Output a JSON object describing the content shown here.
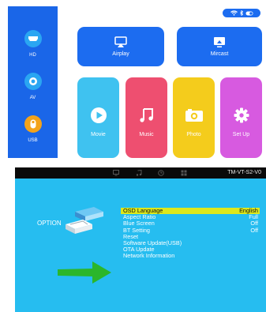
{
  "sidebar": {
    "items": [
      {
        "label": "HD",
        "icon": "hdmi-icon",
        "color": "#2aa6f2"
      },
      {
        "label": "AV",
        "icon": "av-icon",
        "color": "#2aa6f2"
      },
      {
        "label": "USB",
        "icon": "usb-icon",
        "color": "#f3a31b"
      }
    ]
  },
  "status": {
    "icons": [
      "wifi-icon",
      "bluetooth-icon",
      "toggle-icon"
    ]
  },
  "tiles": {
    "airplay": {
      "label": "Airplay",
      "icon": "airplay-icon"
    },
    "mircast": {
      "label": "Mircast",
      "icon": "cast-icon"
    },
    "movie": {
      "label": "Movie",
      "icon": "play-icon"
    },
    "music": {
      "label": "Music",
      "icon": "music-note-icon"
    },
    "photo": {
      "label": "Photo",
      "icon": "camera-icon"
    },
    "setup": {
      "label": "Set Up",
      "icon": "gear-icon"
    }
  },
  "osd": {
    "model": "TM-VT-S2-V0",
    "topbar_icons": [
      "tv-icon",
      "music-icon",
      "clock-icon",
      "grid-icon"
    ],
    "option_title": "OPTION",
    "menu": [
      {
        "label": "OSD Language",
        "value": "English",
        "selected": true
      },
      {
        "label": "Aspect Ratio",
        "value": "Full"
      },
      {
        "label": "Blue Screen",
        "value": "Off"
      },
      {
        "label": "BT Setting",
        "value": "Off"
      },
      {
        "label": "Reset",
        "value": ""
      },
      {
        "label": "Software Update(USB)",
        "value": ""
      },
      {
        "label": "OTA Update",
        "value": ""
      },
      {
        "label": "Network Information",
        "value": ""
      }
    ],
    "colors": {
      "background": "#26bdf0",
      "highlight": "#dde81c",
      "arrow": "#2bb62b"
    }
  }
}
